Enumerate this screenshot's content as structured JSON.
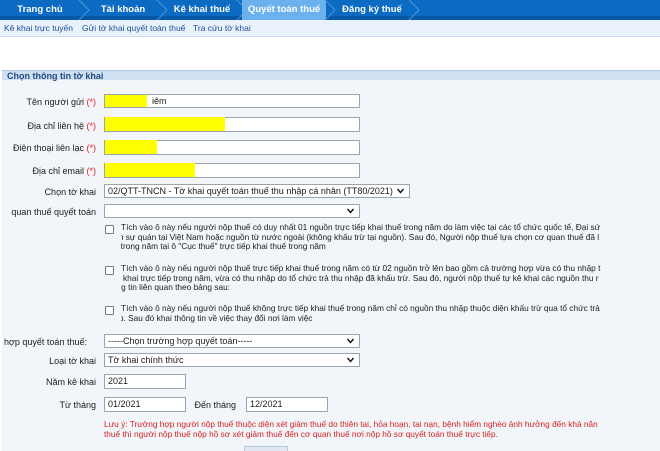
{
  "tabs": [
    {
      "label": "Trang chủ"
    },
    {
      "label": "Tài khoản"
    },
    {
      "label": "Kê khai thuế"
    },
    {
      "label": "Quyết toán thuế"
    },
    {
      "label": "Đăng ký thuế"
    }
  ],
  "subnav": [
    {
      "label": "Kê khai trực tuyến"
    },
    {
      "label": "Gửi tờ khai quyết toán thuế"
    },
    {
      "label": "Tra cứu tờ khai"
    }
  ],
  "section": {
    "title": "Chọn thông tin tờ khai"
  },
  "form": {
    "sender_name": {
      "label": "Tên người gửi",
      "required": "(*)",
      "value": "iêm"
    },
    "address": {
      "label": "Địa chỉ liên hệ",
      "required": "(*)",
      "value": ""
    },
    "phone": {
      "label": "Điện thoại liên lạc",
      "required": "(*)",
      "value": ""
    },
    "email": {
      "label": "Địa chỉ email",
      "required": "(*)",
      "value": ""
    },
    "form_select": {
      "label": "Chọn tờ khai",
      "value": "02/QTT-TNCN - Tờ khai quyết toán thuế thu nhập cá nhân (TT80/2021)"
    },
    "tax_office": {
      "label": "quan thuế quyết toán",
      "value": ""
    },
    "options": [
      {
        "lines": [
          "Tích vào ô này nếu người nộp thuế có duy nhất 01 nguồn trực tiếp khai thuế trong năm do làm việc tại các tổ chức quốc tế, Đại sứ",
          "Lãnh sự quán tại Việt Nam hoặc nguồn từ nước ngoài (không khấu trừ tại nguồn). Sau đó, Người nộp thuế lựa chọn cơ quan thuế đã l",
          "tiếp trong năm tại ô \"Cục thuế\" trực tiếp khai thuế trong năm"
        ]
      },
      {
        "lines": [
          "Tích vào ô này nếu người nộp thuế trực tiếp khai thuế trong năm có từ 02 nguồn trở lên bao gồm cả trường hợp vừa có thu nhập t",
          "diện khai trực tiếp trong năm, vừa có thu nhập do tổ chức trả thu nhập đã khấu trừ. Sau đó, người nộp thuế tự kê khai các nguồn thu r",
          "thông tin liên quan theo bảng sau:"
        ]
      },
      {
        "lines": [
          "Tích vào ô này nếu người nộp thuế không trực tiếp khai thuế trong năm chỉ có nguồn thu nhập thuộc diện khấu trừ qua tổ chức trả",
          "nhập. Sau đó khai thông tin về việc thay đổi nơi làm việc"
        ]
      }
    ],
    "case_select": {
      "label": "hợp quyết toán thuế:",
      "value": "-----Chọn trường hợp quyết toán-----"
    },
    "declaration_type": {
      "label": "Loại tờ khai",
      "value": "Tờ khai chính thức"
    },
    "year": {
      "label": "Năm kê khai",
      "value": "2021"
    },
    "from_month": {
      "label": "Từ tháng",
      "value": "01/2021"
    },
    "to_month": {
      "label": "Đến tháng",
      "value": "12/2021"
    },
    "warning": {
      "lines": [
        "Lưu ý: Trường hợp người nộp thuế thuộc diện xét giảm thuế do thiên tai, hỏa hoạn, tai nạn, bệnh hiểm nghèo ảnh hưởng đến khả năn",
        "thuế thì người nộp thuế nộp hồ sơ xét giảm thuế đến cơ quan thuế nơi nộp hồ sơ quyết toán thuế trực tiếp."
      ]
    }
  },
  "colors": {
    "tab_bar": "#0b6bc2",
    "tab_active": "#6ab1ee",
    "redaction": "#ffff00",
    "warning": "#d62020"
  }
}
